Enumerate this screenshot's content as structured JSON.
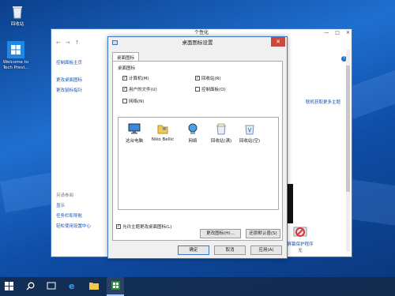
{
  "desktop": {
    "icons": [
      {
        "label": "回收站"
      },
      {
        "label": "Welcome to Tech Previ..."
      }
    ]
  },
  "personalization": {
    "title": "个性化",
    "sidebar_top": "控制面板主页",
    "sidebar_items": [
      "更改桌面图标",
      "更改鼠标指针"
    ],
    "sidebar_see_also": "另请参阅",
    "sidebar_bottom": [
      "显示",
      "任务栏和导航",
      "轻松使用设置中心"
    ],
    "right_link": "联机获取更多主题",
    "screensaver_label": "屏幕保护程序",
    "screensaver_value": "无"
  },
  "dialog": {
    "title": "桌面图标设置",
    "tab": "桌面图标",
    "group": "桌面图标",
    "checkboxes": [
      {
        "label": "计算机(M)",
        "checked": "✓"
      },
      {
        "label": "回收站(R)",
        "checked": "✓"
      },
      {
        "label": "用户的文件(U)",
        "checked": "✓"
      },
      {
        "label": "控制面板(O)",
        "checked": ""
      },
      {
        "label": "网络(N)",
        "checked": ""
      }
    ],
    "icons": [
      "这台电脑",
      "Niko Bellic",
      "网络",
      "回收站(满)",
      "回收站(空)"
    ],
    "change_icon": "更改图标(H)...",
    "restore_default": "还原默认值(S)",
    "allow_themes": "允许主题更改桌面图标(L)",
    "allow_checked": "✓",
    "ok": "确定",
    "cancel": "取消",
    "apply": "应用(A)",
    "close_glyph": "✕"
  },
  "taskbar": {
    "items": [
      "start-icon",
      "search-icon",
      "task-view-icon",
      "ie-icon",
      "file-explorer-icon",
      "store-icon"
    ]
  }
}
